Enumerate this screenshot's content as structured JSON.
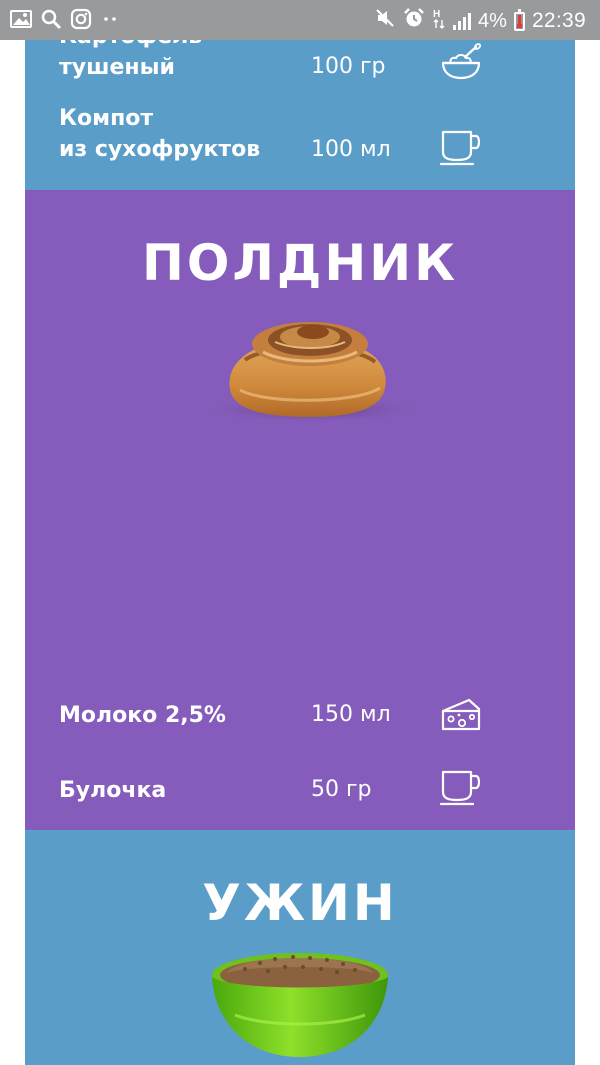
{
  "status_bar": {
    "battery": "4%",
    "time": "22:39",
    "network": "H"
  },
  "lunch": {
    "items": [
      {
        "name": "Картофель\nтушеный",
        "qty": "100 гр",
        "icon": "bowl-icon"
      },
      {
        "name": "Компот\nиз сухофруктов",
        "qty": "100 мл",
        "icon": "cup-icon"
      }
    ]
  },
  "snack": {
    "title": "ПОЛДНИК",
    "image": "cinnamon-bun",
    "items": [
      {
        "name": "Молоко 2,5%",
        "qty": "150 мл",
        "icon": "cheese-icon"
      },
      {
        "name": "Булочка",
        "qty": "50 гр",
        "icon": "cup-icon"
      }
    ]
  },
  "dinner": {
    "title": "УЖИН",
    "image": "buckwheat-bowl"
  },
  "colors": {
    "blue_panel": "#5b9dc9",
    "purple_panel": "#855cbb",
    "status_bar": "#989a9c"
  }
}
